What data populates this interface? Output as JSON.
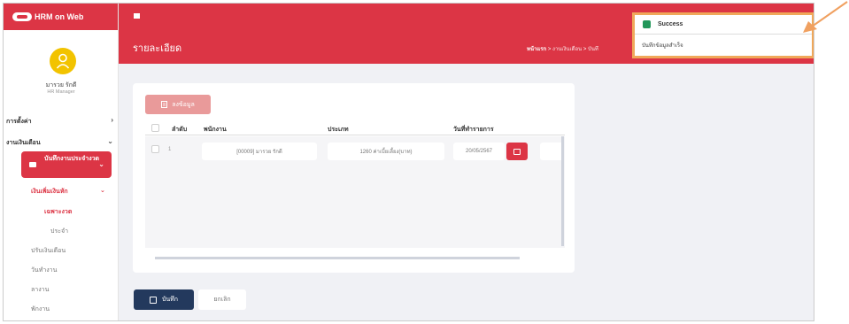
{
  "app": {
    "title": "HRM on Web"
  },
  "user": {
    "name": "มารวย รักดี",
    "role": "HR Manager"
  },
  "sidebar": {
    "settings": "การตั้งค่า",
    "payroll": "งานเงินเดือน",
    "active_item": "บันทึกงานประจำงวด",
    "sub_active": "เงินเพิ่มเงินหัก",
    "sub_period": "เฉพาะงวด",
    "sub_fixed": "ประจำ",
    "salary_adjust": "ปรับเงินเดือน",
    "workdays": "วันทำงาน",
    "leave": "ลางาน",
    "vacation": "พักงาน"
  },
  "header": {
    "page_title": "รายละเอียด",
    "breadcrumb_home": "หน้าแรก",
    "breadcrumb_sep": ">",
    "breadcrumb_payroll": "งานเงินเดือน",
    "breadcrumb_record": "บันทึ"
  },
  "table": {
    "save_data_button": "ลงข้อมูล",
    "columns": [
      "ลำดับ",
      "พนักงาน",
      "ประเภท",
      "วันที่ทำรายการ"
    ],
    "rows": [
      {
        "index": "1",
        "employee": "[00009] มารวย รักดี",
        "type": "1260 ค่าเบี้ยเลี้ยง(บาท)",
        "date": "20/05/2567"
      }
    ]
  },
  "actions": {
    "save": "บันทึก",
    "cancel": "ยกเลิก"
  },
  "toast": {
    "title": "Success",
    "message": "บันทึกข้อมูลสำเร็จ"
  },
  "colors": {
    "primary": "#dc3545",
    "navy": "#23395d",
    "success": "#22975a",
    "highlight": "#f0a85a"
  }
}
